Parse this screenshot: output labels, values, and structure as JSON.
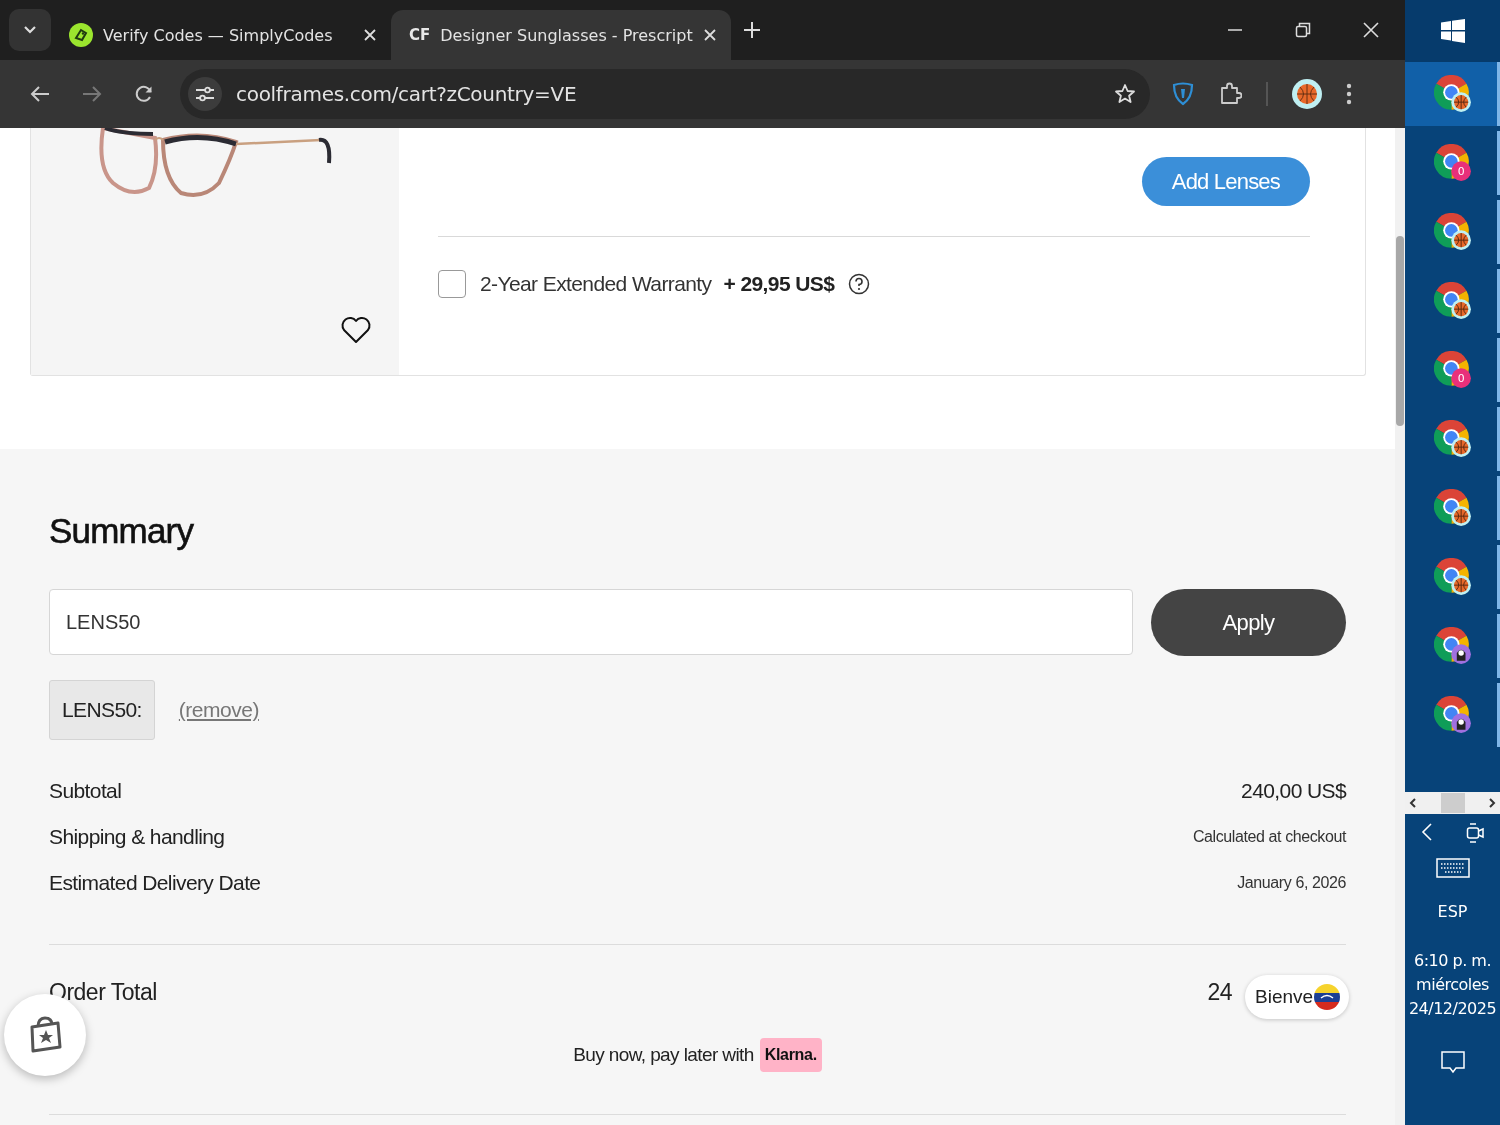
{
  "browser": {
    "tabs": [
      {
        "title": "Verify Codes — SimplyCodes",
        "kind": "tag",
        "selected": false
      },
      {
        "title": "Designer Sunglasses - Prescript",
        "kind": "letters",
        "favicon_text": "CF",
        "selected": true
      }
    ],
    "url": "coolframes.com/cart?zCountry=VE"
  },
  "product": {
    "add_lenses_button": "Add Lenses",
    "warranty": {
      "label": "2-Year Extended Warranty",
      "price": "+ 29,95 US$",
      "checked": false
    }
  },
  "summary": {
    "title": "Summary",
    "promo_field": {
      "value": "LENS50"
    },
    "apply_button": "Apply",
    "applied_code": {
      "code": "LENS50:",
      "remove_link": "(remove)"
    },
    "rows": [
      {
        "label": "Subtotal",
        "value": "240,00 US$",
        "kind": "amount"
      },
      {
        "label": "Shipping & handling",
        "value": "Calculated at checkout",
        "kind": "note"
      },
      {
        "label": "Estimated Delivery Date",
        "value": "January 6, 2026",
        "kind": "note"
      }
    ],
    "order_total": {
      "label": "Order Total",
      "value": "24"
    },
    "klarna": {
      "text": "Buy now, pay later with",
      "logo": "Klarna."
    }
  },
  "welcome_badge": "Bienve",
  "taskbar": {
    "items": [
      {
        "kind": "basketball",
        "selected": true
      },
      {
        "kind": "count",
        "count": "0",
        "selected": false
      },
      {
        "kind": "basketball",
        "selected": false
      },
      {
        "kind": "basketball",
        "selected": false
      },
      {
        "kind": "count",
        "count": "0",
        "selected": false
      },
      {
        "kind": "basketball",
        "selected": false
      },
      {
        "kind": "basketball",
        "selected": false
      },
      {
        "kind": "basketball",
        "selected": false
      },
      {
        "kind": "avatar",
        "selected": false
      },
      {
        "kind": "avatar",
        "selected": false
      }
    ],
    "language": "ESP",
    "time": "6:10 p. m.",
    "day": "miércoles",
    "date": "24/12/2025"
  }
}
